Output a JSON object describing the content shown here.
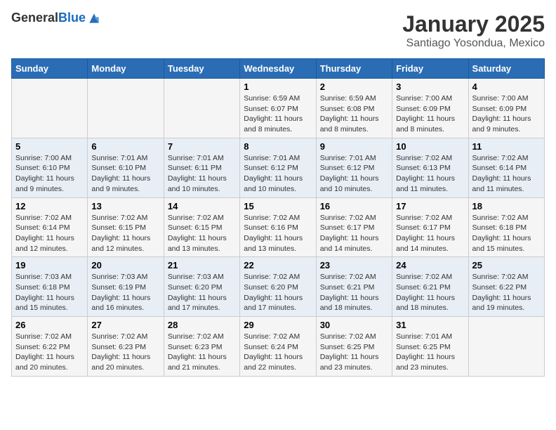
{
  "header": {
    "logo_general": "General",
    "logo_blue": "Blue",
    "title": "January 2025",
    "subtitle": "Santiago Yosondua, Mexico"
  },
  "days_of_week": [
    "Sunday",
    "Monday",
    "Tuesday",
    "Wednesday",
    "Thursday",
    "Friday",
    "Saturday"
  ],
  "weeks": [
    [
      {
        "day": "",
        "info": ""
      },
      {
        "day": "",
        "info": ""
      },
      {
        "day": "",
        "info": ""
      },
      {
        "day": "1",
        "info": "Sunrise: 6:59 AM\nSunset: 6:07 PM\nDaylight: 11 hours and 8 minutes."
      },
      {
        "day": "2",
        "info": "Sunrise: 6:59 AM\nSunset: 6:08 PM\nDaylight: 11 hours and 8 minutes."
      },
      {
        "day": "3",
        "info": "Sunrise: 7:00 AM\nSunset: 6:09 PM\nDaylight: 11 hours and 8 minutes."
      },
      {
        "day": "4",
        "info": "Sunrise: 7:00 AM\nSunset: 6:09 PM\nDaylight: 11 hours and 9 minutes."
      }
    ],
    [
      {
        "day": "5",
        "info": "Sunrise: 7:00 AM\nSunset: 6:10 PM\nDaylight: 11 hours and 9 minutes."
      },
      {
        "day": "6",
        "info": "Sunrise: 7:01 AM\nSunset: 6:10 PM\nDaylight: 11 hours and 9 minutes."
      },
      {
        "day": "7",
        "info": "Sunrise: 7:01 AM\nSunset: 6:11 PM\nDaylight: 11 hours and 10 minutes."
      },
      {
        "day": "8",
        "info": "Sunrise: 7:01 AM\nSunset: 6:12 PM\nDaylight: 11 hours and 10 minutes."
      },
      {
        "day": "9",
        "info": "Sunrise: 7:01 AM\nSunset: 6:12 PM\nDaylight: 11 hours and 10 minutes."
      },
      {
        "day": "10",
        "info": "Sunrise: 7:02 AM\nSunset: 6:13 PM\nDaylight: 11 hours and 11 minutes."
      },
      {
        "day": "11",
        "info": "Sunrise: 7:02 AM\nSunset: 6:14 PM\nDaylight: 11 hours and 11 minutes."
      }
    ],
    [
      {
        "day": "12",
        "info": "Sunrise: 7:02 AM\nSunset: 6:14 PM\nDaylight: 11 hours and 12 minutes."
      },
      {
        "day": "13",
        "info": "Sunrise: 7:02 AM\nSunset: 6:15 PM\nDaylight: 11 hours and 12 minutes."
      },
      {
        "day": "14",
        "info": "Sunrise: 7:02 AM\nSunset: 6:15 PM\nDaylight: 11 hours and 13 minutes."
      },
      {
        "day": "15",
        "info": "Sunrise: 7:02 AM\nSunset: 6:16 PM\nDaylight: 11 hours and 13 minutes."
      },
      {
        "day": "16",
        "info": "Sunrise: 7:02 AM\nSunset: 6:17 PM\nDaylight: 11 hours and 14 minutes."
      },
      {
        "day": "17",
        "info": "Sunrise: 7:02 AM\nSunset: 6:17 PM\nDaylight: 11 hours and 14 minutes."
      },
      {
        "day": "18",
        "info": "Sunrise: 7:02 AM\nSunset: 6:18 PM\nDaylight: 11 hours and 15 minutes."
      }
    ],
    [
      {
        "day": "19",
        "info": "Sunrise: 7:03 AM\nSunset: 6:18 PM\nDaylight: 11 hours and 15 minutes."
      },
      {
        "day": "20",
        "info": "Sunrise: 7:03 AM\nSunset: 6:19 PM\nDaylight: 11 hours and 16 minutes."
      },
      {
        "day": "21",
        "info": "Sunrise: 7:03 AM\nSunset: 6:20 PM\nDaylight: 11 hours and 17 minutes."
      },
      {
        "day": "22",
        "info": "Sunrise: 7:02 AM\nSunset: 6:20 PM\nDaylight: 11 hours and 17 minutes."
      },
      {
        "day": "23",
        "info": "Sunrise: 7:02 AM\nSunset: 6:21 PM\nDaylight: 11 hours and 18 minutes."
      },
      {
        "day": "24",
        "info": "Sunrise: 7:02 AM\nSunset: 6:21 PM\nDaylight: 11 hours and 18 minutes."
      },
      {
        "day": "25",
        "info": "Sunrise: 7:02 AM\nSunset: 6:22 PM\nDaylight: 11 hours and 19 minutes."
      }
    ],
    [
      {
        "day": "26",
        "info": "Sunrise: 7:02 AM\nSunset: 6:22 PM\nDaylight: 11 hours and 20 minutes."
      },
      {
        "day": "27",
        "info": "Sunrise: 7:02 AM\nSunset: 6:23 PM\nDaylight: 11 hours and 20 minutes."
      },
      {
        "day": "28",
        "info": "Sunrise: 7:02 AM\nSunset: 6:23 PM\nDaylight: 11 hours and 21 minutes."
      },
      {
        "day": "29",
        "info": "Sunrise: 7:02 AM\nSunset: 6:24 PM\nDaylight: 11 hours and 22 minutes."
      },
      {
        "day": "30",
        "info": "Sunrise: 7:02 AM\nSunset: 6:25 PM\nDaylight: 11 hours and 23 minutes."
      },
      {
        "day": "31",
        "info": "Sunrise: 7:01 AM\nSunset: 6:25 PM\nDaylight: 11 hours and 23 minutes."
      },
      {
        "day": "",
        "info": ""
      }
    ]
  ]
}
